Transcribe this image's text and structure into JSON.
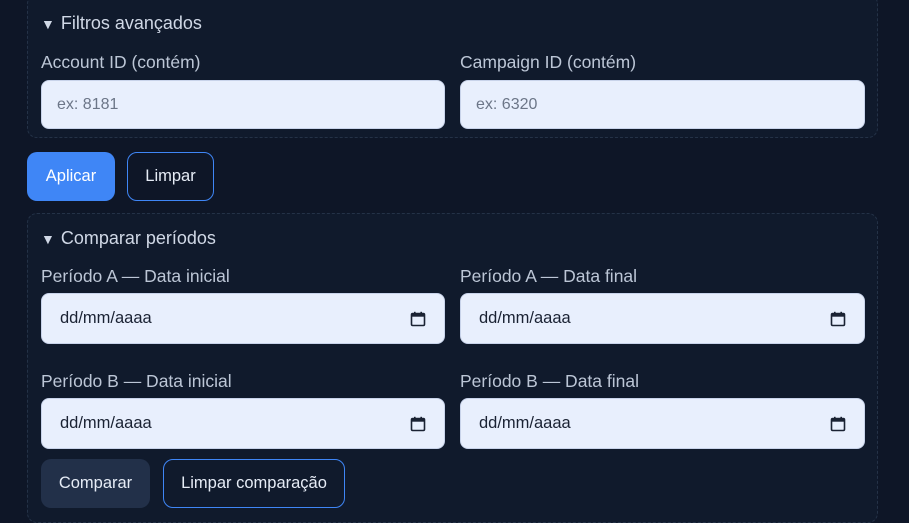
{
  "filters": {
    "summary": "Filtros avançados",
    "account_label": "Account ID (contém)",
    "account_placeholder": "ex: 8181",
    "campaign_label": "Campaign ID (contém)",
    "campaign_placeholder": "ex: 6320"
  },
  "actions": {
    "apply_label": "Aplicar",
    "clear_label": "Limpar"
  },
  "compare": {
    "summary": "Comparar períodos",
    "a_start_label": "Período A — Data inicial",
    "a_end_label": "Período A — Data final",
    "b_start_label": "Período B — Data inicial",
    "b_end_label": "Período B — Data final",
    "date_placeholder": "dd/mm/aaaa",
    "compare_label": "Comparar",
    "clear_compare_label": "Limpar comparação"
  },
  "colors": {
    "background": "#0e1627",
    "accent": "#3f86f6",
    "input_bg": "#e8effd"
  },
  "icons": {
    "disclosure": "triangle-down",
    "date_picker": "calendar"
  }
}
